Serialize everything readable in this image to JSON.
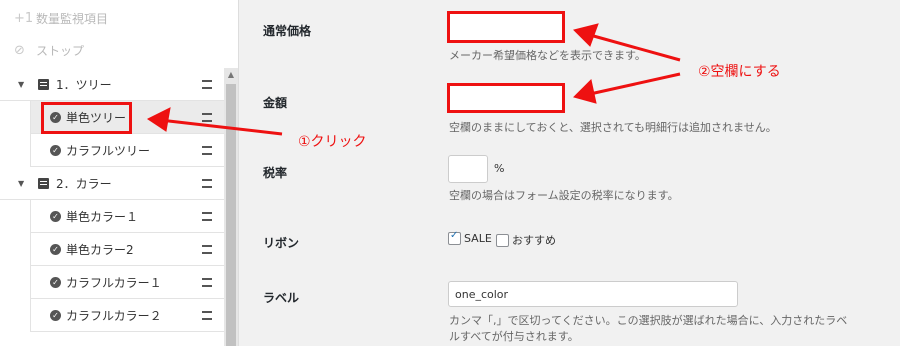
{
  "sidebar": {
    "actions": [
      {
        "icon": "plus-one-icon",
        "glyph": "+1",
        "label": "数量監視項目"
      },
      {
        "icon": "stop-icon",
        "glyph": "⊘",
        "label": "ストップ"
      }
    ],
    "tree": [
      {
        "type": "group",
        "label": "1．ツリー"
      },
      {
        "type": "item",
        "label": "単色ツリー",
        "selected": true
      },
      {
        "type": "item",
        "label": "カラフルツリー"
      },
      {
        "type": "group",
        "label": "2．カラー"
      },
      {
        "type": "item",
        "label": "単色カラー１"
      },
      {
        "type": "item",
        "label": "単色カラー2"
      },
      {
        "type": "item",
        "label": "カラフルカラー１"
      },
      {
        "type": "item",
        "label": "カラフルカラー２"
      }
    ]
  },
  "form": {
    "regular_price": {
      "label": "通常価格",
      "value": "",
      "help": "メーカー希望価格などを表示できます。"
    },
    "amount": {
      "label": "金額",
      "value": "",
      "help": "空欄のままにしておくと、選択されても明細行は追加されません。"
    },
    "tax": {
      "label": "税率",
      "value": "",
      "unit": "%",
      "help": "空欄の場合はフォーム設定の税率になります。"
    },
    "ribbon": {
      "label": "リボン",
      "options": [
        {
          "label": "SALE",
          "checked": true
        },
        {
          "label": "おすすめ",
          "checked": false
        }
      ]
    },
    "tag": {
      "label": "ラベル",
      "value": "one_color",
      "help_line1": "カンマ「,」で区切ってください。この選択肢が選ばれた場合に、入力されたラベ",
      "help_line2": "ルすべてが付与されます。"
    }
  },
  "annotations": {
    "click": "①クリック",
    "blank": "②空欄にする"
  },
  "colors": {
    "highlight": "#ee1111"
  }
}
